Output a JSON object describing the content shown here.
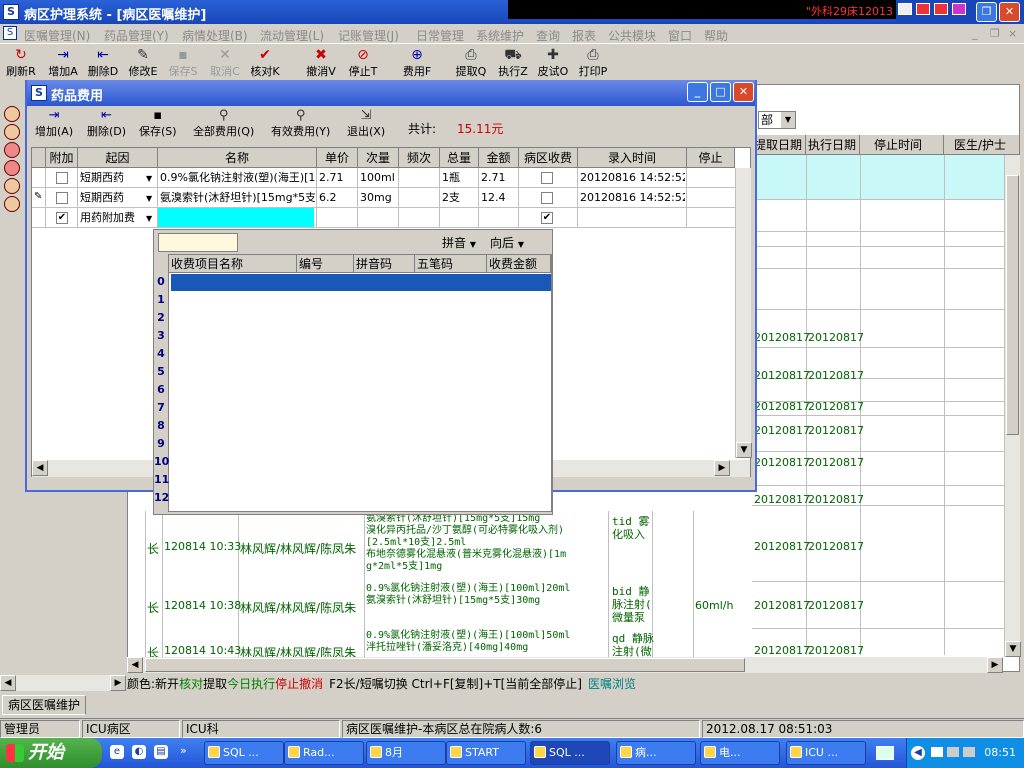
{
  "app": {
    "title": "病区护理系统 - [病区医嘱维护]",
    "marquee": "\"外科29床12013",
    "icon_letter": "S"
  },
  "menu": [
    "医嘱管理(N)",
    "药品管理(Y)",
    "病情处理(B)",
    "流动管理(L)",
    "记账管理(J)",
    "日常管理",
    "系统维护",
    "查询",
    "报表",
    "公共模块",
    "窗口",
    "帮助"
  ],
  "toolbar": [
    {
      "label": "刷新R",
      "icon": "refresh-icon",
      "glyph": "↻",
      "disabled": false
    },
    {
      "label": "增加A",
      "icon": "add-icon",
      "glyph": "⇥",
      "disabled": false
    },
    {
      "label": "删除D",
      "icon": "delete-icon",
      "glyph": "⇤",
      "disabled": false
    },
    {
      "label": "修改E",
      "icon": "edit-icon",
      "glyph": "✎",
      "disabled": false
    },
    {
      "label": "保存S",
      "icon": "save-icon",
      "glyph": "▪",
      "disabled": true
    },
    {
      "label": "取消C",
      "icon": "cancel-icon",
      "glyph": "✕",
      "disabled": true
    },
    {
      "label": "核对K",
      "icon": "check-icon",
      "glyph": "✔",
      "disabled": false
    },
    {
      "label": "撤消V",
      "icon": "undo-icon",
      "glyph": "✖",
      "disabled": false
    },
    {
      "label": "停止T",
      "icon": "stop-icon",
      "glyph": "⊘",
      "disabled": false
    },
    {
      "label": "费用F",
      "icon": "fee-icon",
      "glyph": "⊕",
      "disabled": false
    },
    {
      "label": "提取Q",
      "icon": "extract-icon",
      "glyph": "⎙",
      "disabled": false
    },
    {
      "label": "执行Z",
      "icon": "execute-icon",
      "glyph": "⛟",
      "disabled": false
    },
    {
      "label": "皮试O",
      "icon": "skin-test-icon",
      "glyph": "✚",
      "disabled": false
    },
    {
      "label": "打印P",
      "icon": "print-icon",
      "glyph": "⎙",
      "disabled": false
    }
  ],
  "background_table": {
    "dept_select": "部",
    "headers": [
      "提取日期",
      "执行日期",
      "停止时间",
      "医生/护士"
    ],
    "extract_dates": [
      "20120817",
      "20120817",
      "20120817",
      "20120817",
      "20120817",
      "20120817",
      "20120817",
      "20120817",
      "20120817"
    ],
    "exec_dates": [
      "20120817",
      "20120817",
      "20120817",
      "20120817",
      "20120817",
      "20120817",
      "20120817",
      "20120817",
      "20120817"
    ],
    "orders": [
      {
        "type": "长",
        "time": "120814 10:33",
        "people": "林风辉/林风辉/陈凤朱",
        "text": "氨溴索针(沐舒坦针)[15mg*5支]15mg\n溴化异丙托品/沙丁氨醇(可必特雾化吸入剂)\n[2.5ml*10支]2.5ml\n布地奈德雾化混悬液(普米克雾化混悬液)[1m\ng*2ml*5支]1mg",
        "freq": "tid 雾\n化吸入",
        "rate": "",
        "extract": "20120817",
        "exec": "20120817"
      },
      {
        "type": "长",
        "time": "120814 10:38",
        "people": "林风辉/林风辉/陈凤朱",
        "text": "0.9%氯化钠注射液(塑)(海王)[100ml]20ml\n氨溴索针(沐舒坦针)[15mg*5支]30mg",
        "freq": "bid 静\n脉注射(\n微量泵",
        "rate": "60ml/h",
        "extract": "20120817",
        "exec": "20120817"
      },
      {
        "type": "长",
        "time": "120814 10:43",
        "people": "林风辉/林风辉/陈凤朱",
        "text": "0.9%氯化钠注射液(塑)(海王)[100ml]50ml\n泮托拉唑针(潘妥洛克)[40mg]40mg",
        "freq": "qd 静脉\n注射(微",
        "rate": "",
        "extract": "20120817",
        "exec": "20120817"
      }
    ]
  },
  "legend": {
    "prefix": "颜色:",
    "items": [
      {
        "text": "新开",
        "color": "#000000"
      },
      {
        "text": "核对",
        "color": "#008000"
      },
      {
        "text": "提取",
        "color": "#000000"
      },
      {
        "text": "今日执行",
        "color": "#008000"
      },
      {
        "text": "停止",
        "color": "#cc0000"
      },
      {
        "text": "撤消",
        "color": "#cc0000"
      }
    ],
    "shortcut": "F2长/短嘱切换  Ctrl+F[复制]+T[当前全部停止]",
    "browse": "医嘱浏览"
  },
  "tab": "病区医嘱维护",
  "status": [
    "管理员",
    "ICU病区",
    "ICU科",
    "病区医嘱维护-本病区总在院病人数:6",
    "2012.08.17 08:51:03"
  ],
  "dialog": {
    "title": "药品费用",
    "buttons": [
      {
        "label": "增加(A)",
        "icon": "add-icon",
        "glyph": "⇥"
      },
      {
        "label": "删除(D)",
        "icon": "delete-icon",
        "glyph": "⇤"
      },
      {
        "label": "保存(S)",
        "icon": "save-icon",
        "glyph": "▪"
      },
      {
        "label": "全部费用(Q)",
        "icon": "search-icon",
        "glyph": "⚲"
      },
      {
        "label": "有效费用(Y)",
        "icon": "search-icon",
        "glyph": "⚲"
      },
      {
        "label": "退出(X)",
        "icon": "exit-icon",
        "glyph": "⇲"
      }
    ],
    "total_label": "共计:",
    "total_value": "15.11元",
    "columns": [
      "附加",
      "起因",
      "名称",
      "单价",
      "次量",
      "频次",
      "总量",
      "金额",
      "病区收费",
      "录入时间",
      "停止"
    ],
    "rows": [
      {
        "extra": false,
        "cause": "短期西药",
        "name": "0.9%氯化钠注射液(塑)(海王)[100ml]",
        "price": "2.71",
        "dose": "100ml",
        "freq": "",
        "total": "1瓶",
        "amount": "2.71",
        "ward_fee": false,
        "entry": "20120816 14:52:52"
      },
      {
        "extra": false,
        "cause": "短期西药",
        "name": "氨溴索针(沐舒坦针)[15mg*5支]",
        "price": "6.2",
        "dose": "30mg",
        "freq": "",
        "total": "2支",
        "amount": "12.4",
        "ward_fee": false,
        "entry": "20120816 14:52:52"
      },
      {
        "extra": true,
        "cause": "用药附加费",
        "name": "",
        "price": "",
        "dose": "",
        "freq": "",
        "total": "",
        "amount": "",
        "ward_fee": true,
        "entry": ""
      }
    ]
  },
  "popup": {
    "input_value": "",
    "mode1": "拼音",
    "mode2": "向后",
    "columns": [
      "收费项目名称",
      "编号",
      "拼音码",
      "五笔码",
      "收费金额"
    ],
    "row_numbers": [
      "0",
      "1",
      "2",
      "3",
      "4",
      "5",
      "6",
      "7",
      "8",
      "9",
      "10",
      "11",
      "12"
    ]
  },
  "taskbar": {
    "start": "开始",
    "tasks": [
      "SQL ...",
      "Rad...",
      "8月",
      "START",
      "SQL ...",
      "病...",
      "电...",
      "ICU ..."
    ],
    "clock": "08:51"
  }
}
